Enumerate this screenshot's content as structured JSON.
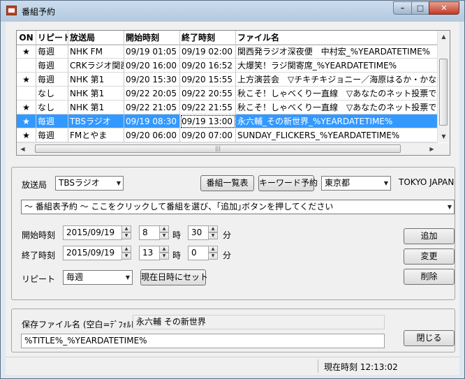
{
  "window": {
    "title": "番組予約",
    "min_glyph": "–",
    "max_glyph": "□",
    "close_glyph": "✕"
  },
  "table": {
    "columns": [
      "ON",
      "リピート",
      "放送局",
      "開始時刻",
      "終了時刻",
      "ファイル名"
    ],
    "rows": [
      {
        "on": "★",
        "repeat": "毎週",
        "station": "NHK FM",
        "start": "09/19 01:05",
        "end": "09/19 02:00",
        "file": "関西発ラジオ深夜便　中村宏_%YEARDATETIME%"
      },
      {
        "on": "",
        "repeat": "毎週",
        "station": "CRKラジオ関西",
        "start": "09/20 16:00",
        "end": "09/20 16:52",
        "file": "大爆笑！ラジ関寄席_%YEARDATETIME%"
      },
      {
        "on": "★",
        "repeat": "毎週",
        "station": "NHK 第1",
        "start": "09/20 15:30",
        "end": "09/20 15:55",
        "file": "上方演芸会　▽チキチキジョニー／海原はるか・かなた_%YEA"
      },
      {
        "on": "",
        "repeat": "なし",
        "station": "NHK 第1",
        "start": "09/22 20:05",
        "end": "09/22 20:55",
        "file": "秋こそ！しゃべくり一直線　▽あなたのネット投票で“しゃべくり王"
      },
      {
        "on": "★",
        "repeat": "なし",
        "station": "NHK 第1",
        "start": "09/22 21:05",
        "end": "09/22 21:55",
        "file": "秋こそ！しゃべくり一直線　▽あなたのネット投票で“しゃべくり王"
      },
      {
        "on": "★",
        "repeat": "毎週",
        "station": "TBSラジオ",
        "start": "09/19 08:30",
        "end": "09/19 13:00",
        "file": "永六輔_その新世界_%YEARDATETIME%"
      },
      {
        "on": "★",
        "repeat": "毎週",
        "station": "FMとやま",
        "start": "09/20 06:00",
        "end": "09/20 07:00",
        "file": "SUNDAY_FLICKERS_%YEARDATETIME%"
      }
    ],
    "selected_index": 5,
    "hscroll_grip": "|||"
  },
  "station_panel": {
    "station_label": "放送局",
    "station_value": "TBSラジオ",
    "program_list_button": "番組一覧表",
    "keyword_button": "キーワード予約",
    "area_value": "東京都",
    "area_text": "TOKYO JAPAN",
    "program_combo": "～ 番組表予約 ～ ここをクリックして番組を選び、｢追加｣ボタンを押してください",
    "start_label": "開始時刻",
    "start_date": "2015/09/19",
    "start_hour": "8",
    "start_minute": "30",
    "end_label": "終了時刻",
    "end_date": "2015/09/19",
    "end_hour": "13",
    "end_minute": "0",
    "hour_unit": "時",
    "minute_unit": "分",
    "repeat_label": "リピート",
    "repeat_value": "毎週",
    "set_now_button": "現在日時にセット",
    "add_button": "追加",
    "change_button": "変更",
    "delete_button": "削除"
  },
  "file_panel": {
    "filename_label": "保存ファイル名 (空白=ﾃﾞﾌｫﾙﾄ)",
    "program_title": "永六輔 その新世界",
    "filename_value": "%TITLE%_%YEARDATETIME%",
    "close_button": "閉じる"
  },
  "status_bar": {
    "current_time": "現在時刻 12:13:02"
  }
}
